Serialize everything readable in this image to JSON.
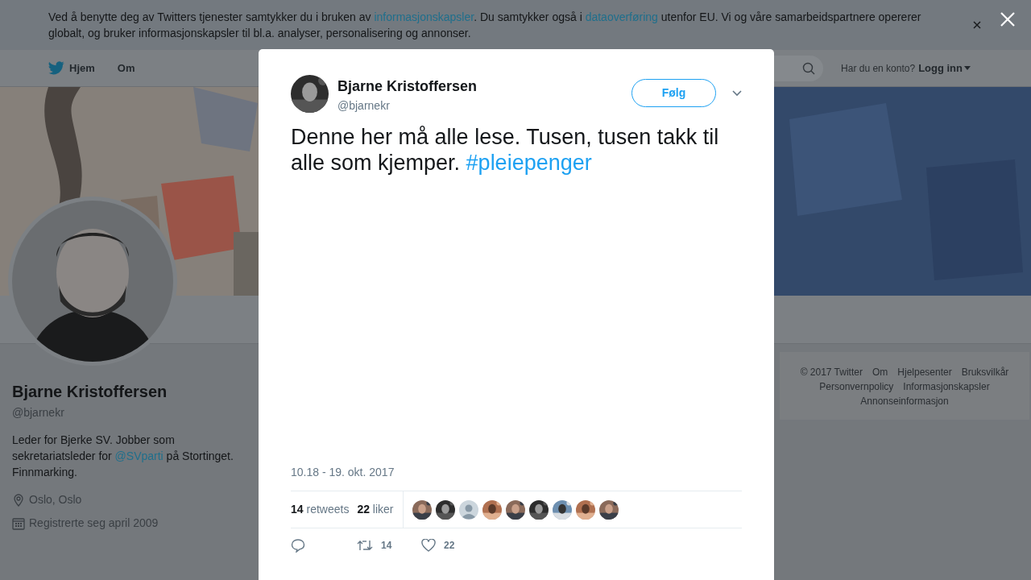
{
  "cookie_banner": {
    "parts": [
      {
        "text": "Ved å benytte deg av Twitters tjenester samtykker du i bruken av ",
        "link": false
      },
      {
        "text": "informasjonskapsler",
        "link": true
      },
      {
        "text": ". Du samtykker også i ",
        "link": false
      },
      {
        "text": "dataoverføring",
        "link": true
      },
      {
        "text": " utenfor EU. Vi og våre samarbeidspartnere opererer globalt, og bruker informasjonskapsler til bl.a. analyser, personalisering og annonser.",
        "link": false
      }
    ]
  },
  "nav": {
    "items": [
      {
        "label": "Hjem"
      },
      {
        "label": "Om"
      }
    ],
    "login_prompt": "Har du en konto?",
    "login_link": "Logg inn"
  },
  "profile": {
    "name": "Bjarne Kristoffersen",
    "handle": "@bjarnekr",
    "bio": [
      {
        "text": "Leder for Bjerke SV. Jobber som sekretariatsleder for ",
        "link": false
      },
      {
        "text": "@SVparti",
        "link": true
      },
      {
        "text": " på Stortinget. Finnmarking.",
        "link": false
      }
    ],
    "location": "Oslo, Oslo",
    "joined": "Registrerte seg april 2009"
  },
  "footer": {
    "links": [
      "© 2017 Twitter",
      "Om",
      "Hjelpesenter",
      "Bruksvilkår",
      "Personvernpolicy",
      "Informasjonskapsler",
      "Annonseinformasjon"
    ]
  },
  "tweet": {
    "author": "Bjarne Kristoffersen",
    "handle": "@bjarnekr",
    "follow_button": "Følg",
    "text": [
      {
        "text": "Denne her må alle lese. Tusen, tusen takk til alle som kjemper. ",
        "link": false
      },
      {
        "text": "#pleiepenger",
        "link": true
      }
    ],
    "timestamp": "10.18 - 19. okt. 2017",
    "retweet_count": "14",
    "retweet_label": "retweets",
    "like_count": "22",
    "like_label": "liker",
    "likers": [
      {
        "kind": "picture"
      },
      {
        "kind": "picture"
      },
      {
        "kind": "default"
      },
      {
        "kind": "picture"
      },
      {
        "kind": "picture"
      },
      {
        "kind": "picture"
      },
      {
        "kind": "picture"
      },
      {
        "kind": "picture"
      },
      {
        "kind": "picture"
      }
    ],
    "actions": [
      {
        "kind": "reply"
      },
      {
        "kind": "retweet",
        "count": "14"
      },
      {
        "kind": "like",
        "count": "22"
      }
    ]
  }
}
